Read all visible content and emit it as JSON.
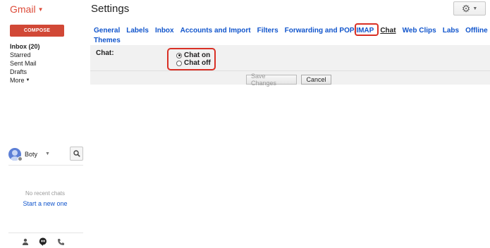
{
  "header": {
    "logo_text": "Gmail",
    "page_title": "Settings",
    "settings_icon": "gear-icon"
  },
  "sidebar": {
    "compose_label": "COMPOSE",
    "items": [
      {
        "label": "Inbox (20)",
        "bold": true
      },
      {
        "label": "Starred"
      },
      {
        "label": "Sent Mail"
      },
      {
        "label": "Drafts"
      },
      {
        "label": "More",
        "has_caret": true
      }
    ]
  },
  "chat": {
    "user_name": "Boty",
    "no_chats_text": "No recent chats",
    "start_chat_text": "Start a new one"
  },
  "tabs": {
    "row1": [
      "General",
      "Labels",
      "Inbox",
      "Accounts and Import",
      "Filters",
      "Forwarding and POP/IMAP",
      "Chat",
      "Web Clips",
      "Labs",
      "Offline"
    ],
    "row2": [
      "Themes"
    ],
    "active": "Chat"
  },
  "settings": {
    "chat_label": "Chat:",
    "option_on": "Chat on",
    "option_off": "Chat off",
    "selected": "Chat on"
  },
  "buttons": {
    "save_label": "Save Changes",
    "cancel_label": "Cancel"
  },
  "colors": {
    "brand_red": "#dd4b39",
    "compose_red": "#d14836",
    "link_blue": "#1155cc",
    "highlight_red": "#d93025"
  }
}
